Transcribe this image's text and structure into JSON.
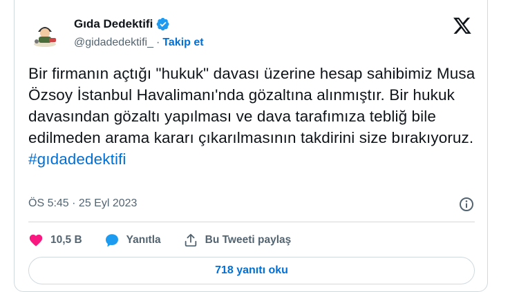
{
  "author": {
    "display_name": "Gıda Dedektifi",
    "handle": "@gidadedektifi_",
    "separator": "·",
    "follow_label": "Takip et"
  },
  "tweet": {
    "text": "Bir firmanın açtığı \"hukuk\" davası üzerine hesap sahibimiz Musa Özsoy İstanbul Havalimanı'nda gözaltına alınmıştır. Bir hukuk davasından gözaltı yapılması ve dava tarafımıza tebliğ bile edilmeden arama kararı çıkarılmasının takdirini size bırakıyoruz.",
    "hashtag": "#gıdadedektifi",
    "timestamp": "ÖS 5:45 · 25 Eyl 2023"
  },
  "actions": {
    "likes": "10,5 B",
    "reply_label": "Yanıtla",
    "share_label": "Bu Tweeti paylaş"
  },
  "read_replies_label": "718 yanıtı oku",
  "colors": {
    "accent": "#006fd6",
    "like": "#f91880",
    "reply_icon": "#1d9bf0",
    "text": "#0f1419",
    "muted": "#536471",
    "border": "#cfd9de"
  },
  "icons": [
    "verified-badge-icon",
    "x-logo-icon",
    "info-icon",
    "heart-icon",
    "reply-bubble-icon",
    "share-icon"
  ]
}
